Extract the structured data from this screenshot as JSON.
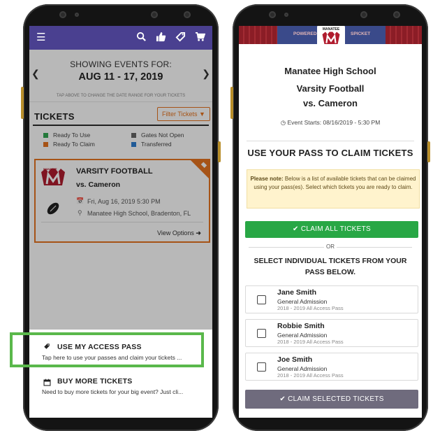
{
  "left": {
    "header_icons": [
      "hamburger-icon",
      "search-icon",
      "thumbs-up-icon",
      "tag-icon",
      "cart-icon"
    ],
    "showing_label": "SHOWING EVENTS FOR:",
    "date_range": "AUG 11 - 17, 2019",
    "tap_hint": "TAP ABOVE TO CHANGE THE DATE RANGE FOR YOUR TICKETS",
    "tickets_title": "TICKETS",
    "filter_label": "Filter Tickets",
    "legend": [
      {
        "label": "Ready To Use",
        "color": "#33a852"
      },
      {
        "label": "Ready To Claim",
        "color": "#e6741f"
      },
      {
        "label": "Gates Not Open",
        "color": "#666666"
      },
      {
        "label": "Transferred",
        "color": "#2f7fd1"
      }
    ],
    "event": {
      "title": "VARSITY FOOTBALL",
      "opponent": "vs. Cameron",
      "datetime": "Fri, Aug 16, 2019 5:30 PM",
      "location": "Manatee High School, Bradenton, FL",
      "view_options": "View Options",
      "logo_text": "MANATEE"
    },
    "sheet": [
      {
        "title": "USE MY ACCESS PASS",
        "desc": "Tap here to use your passes and claim your tickets ..."
      },
      {
        "title": "BUY MORE TICKETS",
        "desc": "Need to buy more tickets for your big event? Just cli..."
      }
    ]
  },
  "right": {
    "banner_text_left": "POWERED",
    "banner_text_right": "SPICKET",
    "logo_text": "MANATEE",
    "school": "Manatee High School",
    "event_name": "Varsity Football",
    "opponent": "vs. Cameron",
    "event_starts": "Event Starts: 08/16/2019 - 5:30 PM",
    "section_title": "USE YOUR PASS TO CLAIM TICKETS",
    "note_bold": "Please note:",
    "note_text": " Below is a list of available tickets that can be claimed using your pass(es). Select which tickets you are ready to claim.",
    "claim_all": "CLAIM ALL TICKETS",
    "or": "OR",
    "select_title": "SELECT INDIVIDUAL TICKETS FROM YOUR PASS BELOW.",
    "tickets": [
      {
        "name": "Jane Smith",
        "type": "General Admission",
        "pass": "2018 - 2019 All Access Pass"
      },
      {
        "name": "Robbie Smith",
        "type": "General Admission",
        "pass": "2018 - 2019 All Access Pass"
      },
      {
        "name": "Joe Smith",
        "type": "General Admission",
        "pass": "2018 - 2019 All Access Pass"
      }
    ],
    "claim_selected": "CLAIM SELECTED TICKETS"
  }
}
